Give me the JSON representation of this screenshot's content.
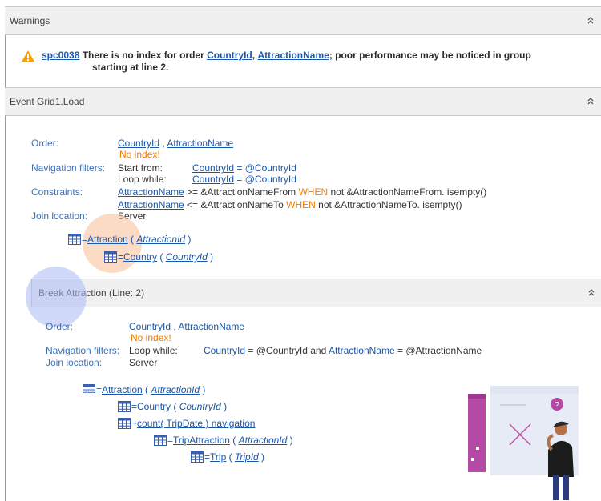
{
  "warnings": {
    "header": "Warnings",
    "code": "spc0038",
    "message_prefix": "There is no index for order",
    "field1": "CountryId",
    "sep": ",",
    "field2": "AttractionName",
    "message_suffix": "; poor performance may be noticed in group",
    "message_line2": "starting at line 2."
  },
  "event": {
    "header": "Event Grid1.Load",
    "order_label": "Order:",
    "order_field1": "CountryId",
    "order_sep": " ,",
    "order_field2": "AttractionName",
    "no_index": "No index!",
    "nav_label": "Navigation filters:",
    "start_from": "Start from:",
    "start_field": "CountryId",
    "start_expr": "= @CountryId",
    "loop_while": "Loop while:",
    "loop_field": "CountryId",
    "loop_expr": "= @CountryId",
    "constraints_label": "Constraints:",
    "c1_field": "AttractionName",
    "c1_expr": ">= &AttractionNameFrom",
    "c1_kw": "WHEN",
    "c1_tail": "not &AttractionNameFrom. isempty()",
    "c2_field": "AttractionName",
    "c2_expr": "<= &AttractionNameTo",
    "c2_kw": "WHEN",
    "c2_tail": "not &AttractionNameTo. isempty()",
    "join_label": "Join location:",
    "join_value": "Server",
    "tree": [
      {
        "prefix": "=",
        "name": "Attraction",
        "open": " ( ",
        "key": "AttractionId",
        "close": " )"
      },
      {
        "prefix": "=",
        "name": "Country",
        "open": " ( ",
        "key": "CountryId",
        "close": " )"
      }
    ]
  },
  "break": {
    "header": "Break Attraction (Line: 2)",
    "order_label": "Order:",
    "order_field1": "CountryId",
    "order_sep": " ,",
    "order_field2": "AttractionName",
    "no_index": "No index!",
    "nav_label": "Navigation filters:",
    "loop_while": "Loop while:",
    "loop_field1": "CountryId",
    "loop_expr1": "= @CountryId and",
    "loop_field2": "AttractionName",
    "loop_expr2": "= @AttractionName",
    "join_label": "Join location:",
    "join_value": "Server",
    "tree": [
      {
        "prefix": "=",
        "name": "Attraction",
        "open": " ( ",
        "key": "AttractionId",
        "close": " )"
      },
      {
        "prefix": "=",
        "name": "Country",
        "open": " ( ",
        "key": "CountryId",
        "close": " )"
      },
      {
        "prefix": "~",
        "name": "count( TripDate ) navigation",
        "open": "",
        "key": "",
        "close": ""
      },
      {
        "prefix": "=",
        "name": "TripAttraction",
        "open": " ( ",
        "key": "AttractionId",
        "close": " )"
      },
      {
        "prefix": "=",
        "name": "Trip",
        "open": " ( ",
        "key": "TripId",
        "close": " )"
      }
    ]
  },
  "colors": {
    "link": "#1a57a8",
    "label": "#3b6fb6",
    "keyword": "#ef7d00",
    "header_bg": "#f0f0f0",
    "warning_icon": "#f5a300"
  }
}
